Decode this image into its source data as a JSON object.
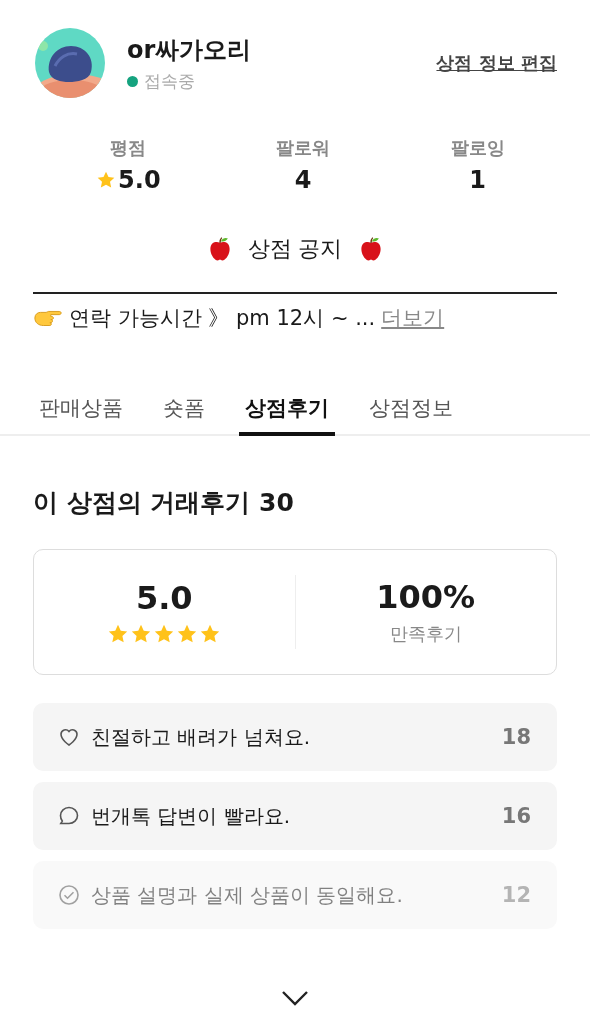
{
  "profile": {
    "name": "or싸가오리",
    "status": "접속중",
    "online": true,
    "edit_link": "상점 정보 편집"
  },
  "stats": [
    {
      "label": "평점",
      "value": "5.0",
      "kind": "rating"
    },
    {
      "label": "팔로워",
      "value": "4",
      "kind": "count"
    },
    {
      "label": "팔로잉",
      "value": "1",
      "kind": "count"
    }
  ],
  "notice": {
    "title": "상점 공지",
    "text": "연락 가능시간 》 pm 12시 ~ ...",
    "more_link": "더보기"
  },
  "tabs": [
    {
      "label": "판매상품",
      "selected": false
    },
    {
      "label": "숏폼",
      "selected": false
    },
    {
      "label": "상점후기",
      "selected": true
    },
    {
      "label": "상점정보",
      "selected": false
    }
  ],
  "reviews": {
    "heading": "이 상점의 거래후기 30",
    "rating": "5.0",
    "stars": 5,
    "satisfaction": "100%",
    "satisfaction_label": "만족후기",
    "items": [
      {
        "kind": "heart",
        "text": "친절하고 배려가 넘쳐요.",
        "count": "18",
        "faded": false
      },
      {
        "kind": "chat",
        "text": "번개톡 답변이 빨라요.",
        "count": "16",
        "faded": false
      },
      {
        "kind": "check",
        "text": "상품 설명과 실제 상품이 동일해요.",
        "count": "12",
        "faded": true
      }
    ]
  }
}
